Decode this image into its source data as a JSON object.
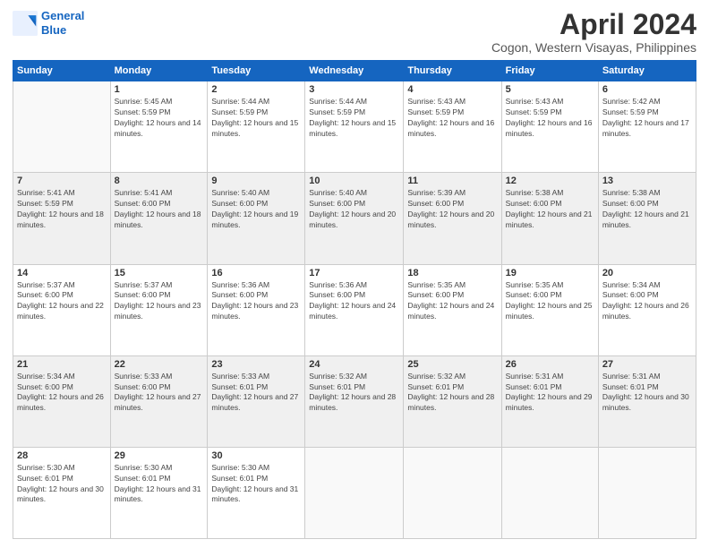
{
  "logo": {
    "line1": "General",
    "line2": "Blue"
  },
  "title": "April 2024",
  "subtitle": "Cogon, Western Visayas, Philippines",
  "columns": [
    "Sunday",
    "Monday",
    "Tuesday",
    "Wednesday",
    "Thursday",
    "Friday",
    "Saturday"
  ],
  "weeks": [
    [
      {
        "num": "",
        "sunrise": "",
        "sunset": "",
        "daylight": ""
      },
      {
        "num": "1",
        "sunrise": "Sunrise: 5:45 AM",
        "sunset": "Sunset: 5:59 PM",
        "daylight": "Daylight: 12 hours and 14 minutes."
      },
      {
        "num": "2",
        "sunrise": "Sunrise: 5:44 AM",
        "sunset": "Sunset: 5:59 PM",
        "daylight": "Daylight: 12 hours and 15 minutes."
      },
      {
        "num": "3",
        "sunrise": "Sunrise: 5:44 AM",
        "sunset": "Sunset: 5:59 PM",
        "daylight": "Daylight: 12 hours and 15 minutes."
      },
      {
        "num": "4",
        "sunrise": "Sunrise: 5:43 AM",
        "sunset": "Sunset: 5:59 PM",
        "daylight": "Daylight: 12 hours and 16 minutes."
      },
      {
        "num": "5",
        "sunrise": "Sunrise: 5:43 AM",
        "sunset": "Sunset: 5:59 PM",
        "daylight": "Daylight: 12 hours and 16 minutes."
      },
      {
        "num": "6",
        "sunrise": "Sunrise: 5:42 AM",
        "sunset": "Sunset: 5:59 PM",
        "daylight": "Daylight: 12 hours and 17 minutes."
      }
    ],
    [
      {
        "num": "7",
        "sunrise": "Sunrise: 5:41 AM",
        "sunset": "Sunset: 5:59 PM",
        "daylight": "Daylight: 12 hours and 18 minutes."
      },
      {
        "num": "8",
        "sunrise": "Sunrise: 5:41 AM",
        "sunset": "Sunset: 6:00 PM",
        "daylight": "Daylight: 12 hours and 18 minutes."
      },
      {
        "num": "9",
        "sunrise": "Sunrise: 5:40 AM",
        "sunset": "Sunset: 6:00 PM",
        "daylight": "Daylight: 12 hours and 19 minutes."
      },
      {
        "num": "10",
        "sunrise": "Sunrise: 5:40 AM",
        "sunset": "Sunset: 6:00 PM",
        "daylight": "Daylight: 12 hours and 20 minutes."
      },
      {
        "num": "11",
        "sunrise": "Sunrise: 5:39 AM",
        "sunset": "Sunset: 6:00 PM",
        "daylight": "Daylight: 12 hours and 20 minutes."
      },
      {
        "num": "12",
        "sunrise": "Sunrise: 5:38 AM",
        "sunset": "Sunset: 6:00 PM",
        "daylight": "Daylight: 12 hours and 21 minutes."
      },
      {
        "num": "13",
        "sunrise": "Sunrise: 5:38 AM",
        "sunset": "Sunset: 6:00 PM",
        "daylight": "Daylight: 12 hours and 21 minutes."
      }
    ],
    [
      {
        "num": "14",
        "sunrise": "Sunrise: 5:37 AM",
        "sunset": "Sunset: 6:00 PM",
        "daylight": "Daylight: 12 hours and 22 minutes."
      },
      {
        "num": "15",
        "sunrise": "Sunrise: 5:37 AM",
        "sunset": "Sunset: 6:00 PM",
        "daylight": "Daylight: 12 hours and 23 minutes."
      },
      {
        "num": "16",
        "sunrise": "Sunrise: 5:36 AM",
        "sunset": "Sunset: 6:00 PM",
        "daylight": "Daylight: 12 hours and 23 minutes."
      },
      {
        "num": "17",
        "sunrise": "Sunrise: 5:36 AM",
        "sunset": "Sunset: 6:00 PM",
        "daylight": "Daylight: 12 hours and 24 minutes."
      },
      {
        "num": "18",
        "sunrise": "Sunrise: 5:35 AM",
        "sunset": "Sunset: 6:00 PM",
        "daylight": "Daylight: 12 hours and 24 minutes."
      },
      {
        "num": "19",
        "sunrise": "Sunrise: 5:35 AM",
        "sunset": "Sunset: 6:00 PM",
        "daylight": "Daylight: 12 hours and 25 minutes."
      },
      {
        "num": "20",
        "sunrise": "Sunrise: 5:34 AM",
        "sunset": "Sunset: 6:00 PM",
        "daylight": "Daylight: 12 hours and 26 minutes."
      }
    ],
    [
      {
        "num": "21",
        "sunrise": "Sunrise: 5:34 AM",
        "sunset": "Sunset: 6:00 PM",
        "daylight": "Daylight: 12 hours and 26 minutes."
      },
      {
        "num": "22",
        "sunrise": "Sunrise: 5:33 AM",
        "sunset": "Sunset: 6:00 PM",
        "daylight": "Daylight: 12 hours and 27 minutes."
      },
      {
        "num": "23",
        "sunrise": "Sunrise: 5:33 AM",
        "sunset": "Sunset: 6:01 PM",
        "daylight": "Daylight: 12 hours and 27 minutes."
      },
      {
        "num": "24",
        "sunrise": "Sunrise: 5:32 AM",
        "sunset": "Sunset: 6:01 PM",
        "daylight": "Daylight: 12 hours and 28 minutes."
      },
      {
        "num": "25",
        "sunrise": "Sunrise: 5:32 AM",
        "sunset": "Sunset: 6:01 PM",
        "daylight": "Daylight: 12 hours and 28 minutes."
      },
      {
        "num": "26",
        "sunrise": "Sunrise: 5:31 AM",
        "sunset": "Sunset: 6:01 PM",
        "daylight": "Daylight: 12 hours and 29 minutes."
      },
      {
        "num": "27",
        "sunrise": "Sunrise: 5:31 AM",
        "sunset": "Sunset: 6:01 PM",
        "daylight": "Daylight: 12 hours and 30 minutes."
      }
    ],
    [
      {
        "num": "28",
        "sunrise": "Sunrise: 5:30 AM",
        "sunset": "Sunset: 6:01 PM",
        "daylight": "Daylight: 12 hours and 30 minutes."
      },
      {
        "num": "29",
        "sunrise": "Sunrise: 5:30 AM",
        "sunset": "Sunset: 6:01 PM",
        "daylight": "Daylight: 12 hours and 31 minutes."
      },
      {
        "num": "30",
        "sunrise": "Sunrise: 5:30 AM",
        "sunset": "Sunset: 6:01 PM",
        "daylight": "Daylight: 12 hours and 31 minutes."
      },
      {
        "num": "",
        "sunrise": "",
        "sunset": "",
        "daylight": ""
      },
      {
        "num": "",
        "sunrise": "",
        "sunset": "",
        "daylight": ""
      },
      {
        "num": "",
        "sunrise": "",
        "sunset": "",
        "daylight": ""
      },
      {
        "num": "",
        "sunrise": "",
        "sunset": "",
        "daylight": ""
      }
    ]
  ]
}
